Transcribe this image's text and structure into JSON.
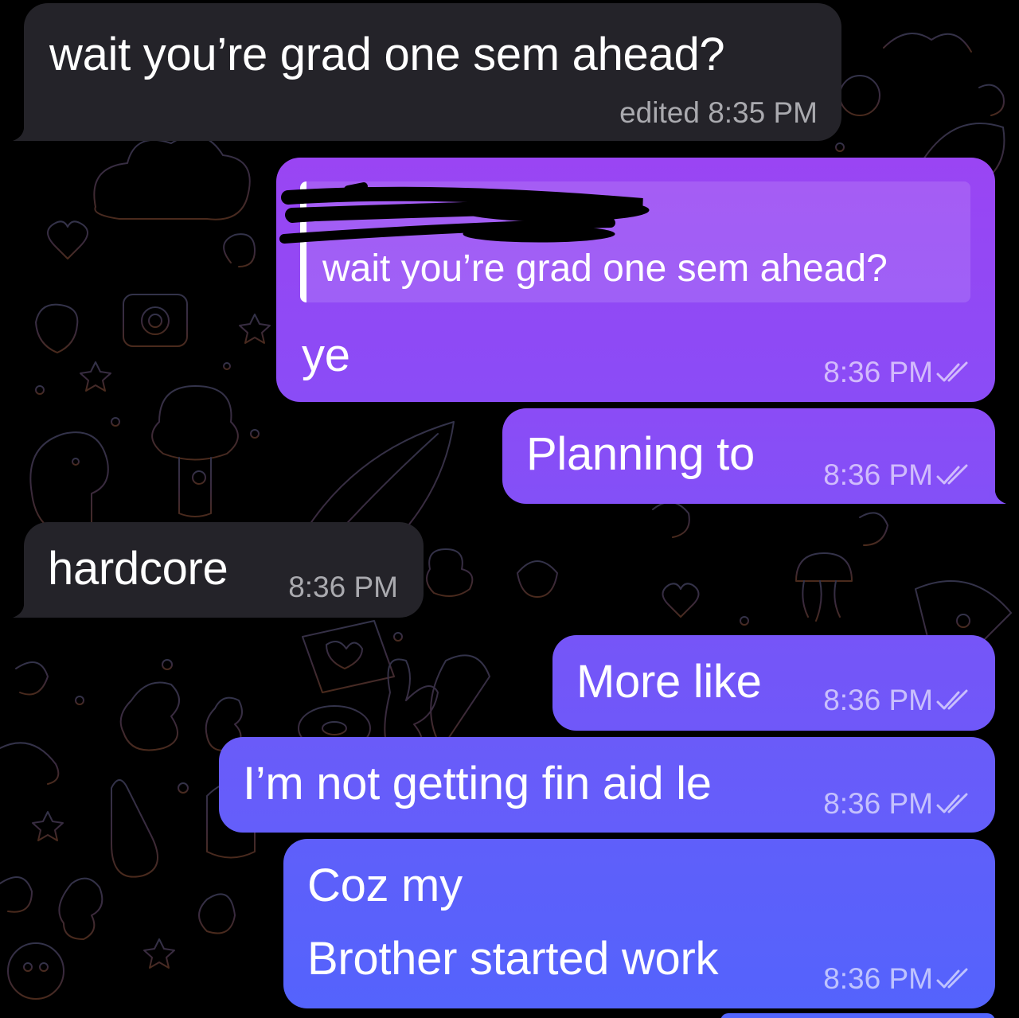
{
  "messages": [
    {
      "direction": "incoming",
      "text": "wait you’re grad one sem ahead?",
      "meta": "edited 8:35 PM"
    },
    {
      "direction": "outgoing",
      "reply_to": "wait you’re grad one sem ahead?",
      "text": "ye",
      "time": "8:36 PM",
      "read": true
    },
    {
      "direction": "outgoing",
      "text": "Planning to",
      "time": "8:36 PM",
      "read": true
    },
    {
      "direction": "incoming",
      "text": "hardcore",
      "time": "8:36 PM"
    },
    {
      "direction": "outgoing",
      "text": "More like",
      "time": "8:36 PM",
      "read": true
    },
    {
      "direction": "outgoing",
      "text": "I’m not getting fin aid le",
      "time": "8:36 PM",
      "read": true
    },
    {
      "direction": "outgoing",
      "lines": [
        "Coz my",
        "Brother started work"
      ],
      "time": "8:36 PM",
      "read": true
    }
  ],
  "icons": {
    "read_receipt": "double-check-icon",
    "reply_sender": "redacted-scribble"
  },
  "colors": {
    "background": "#000000",
    "incoming_bubble": "#242329",
    "outgoing_gradient_top": "#9b47f4",
    "outgoing_gradient_bottom": "#5562ff"
  }
}
